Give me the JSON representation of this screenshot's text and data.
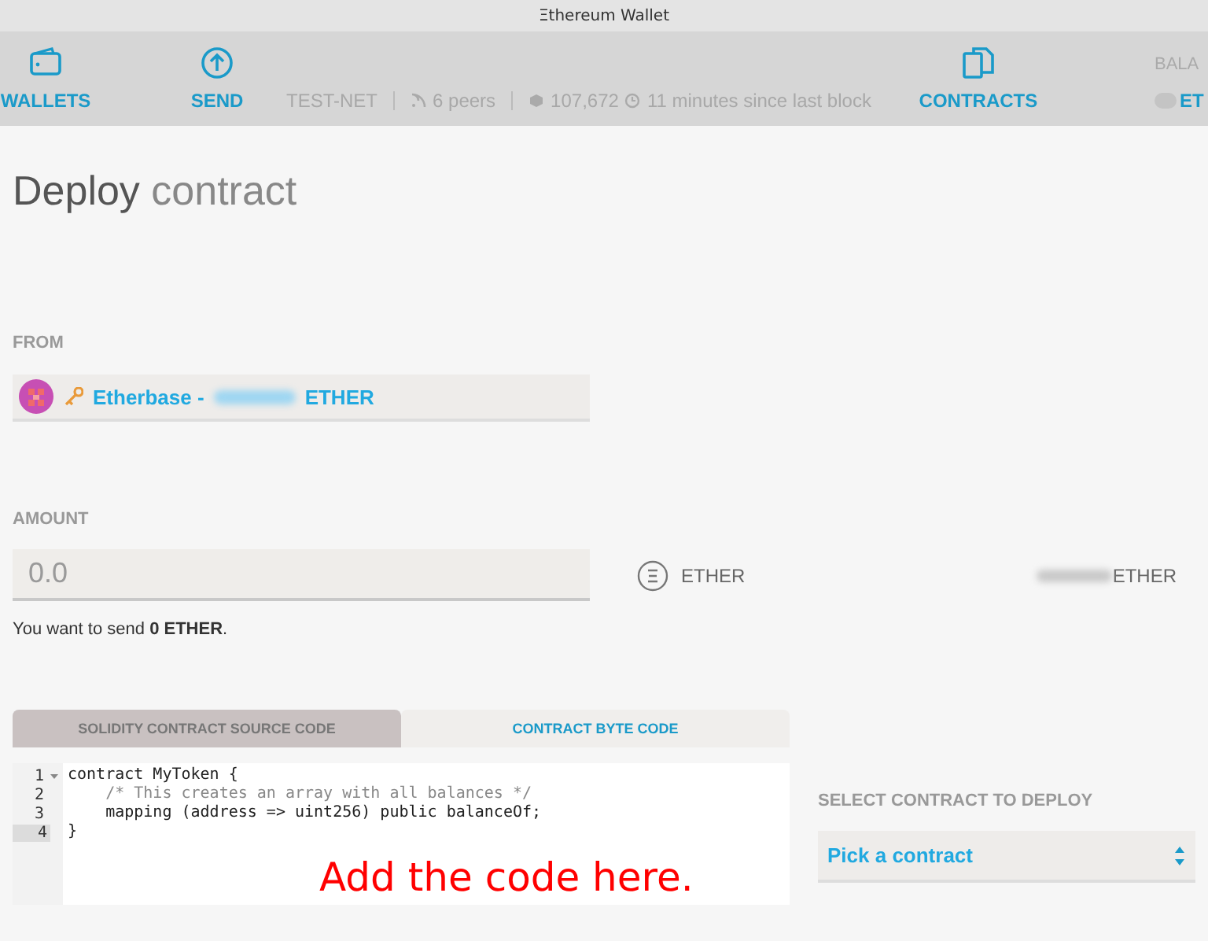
{
  "window": {
    "title": "Ξthereum Wallet"
  },
  "nav": [
    {
      "label": "WALLETS"
    },
    {
      "label": "SEND"
    },
    {
      "label": "CONTRACTS"
    }
  ],
  "status": {
    "network": "TEST-NET",
    "peers": "6 peers",
    "block": "107,672",
    "time": "11 minutes since last block"
  },
  "balance": {
    "label": "BALA",
    "unit": "ET"
  },
  "heading": "**Deploy** contract",
  "from": {
    "label": "FROM",
    "account": "Etherbase -",
    "unit": "ETHER"
  },
  "amount": {
    "label": "AMOUNT",
    "placeholder": "0.0",
    "currency": "ETHER",
    "balance_unit": "ETHER",
    "summary": "You want to send **0 ETHER**."
  },
  "tabs": [
    {
      "label": "SOLIDITY CONTRACT SOURCE CODE",
      "selected": true
    },
    {
      "label": "CONTRACT BYTE CODE",
      "selected": false
    }
  ],
  "editor": {
    "lines": [
      {
        "number": "1",
        "kind": "code",
        "text": "contract MyToken {",
        "fold": true,
        "selected": false
      },
      {
        "number": "2",
        "kind": "comment",
        "text": "    /* This creates an array with all balances */",
        "fold": false,
        "selected": false
      },
      {
        "number": "3",
        "kind": "code",
        "text": "    mapping (address => uint256) public balanceOf;",
        "fold": false,
        "selected": false
      },
      {
        "number": "4",
        "kind": "code",
        "text": "}",
        "fold": false,
        "selected": true
      }
    ]
  },
  "annotation": "Add the code here.",
  "deploy": {
    "label": "SELECT CONTRACT TO DEPLOY",
    "value": "Pick a contract"
  }
}
